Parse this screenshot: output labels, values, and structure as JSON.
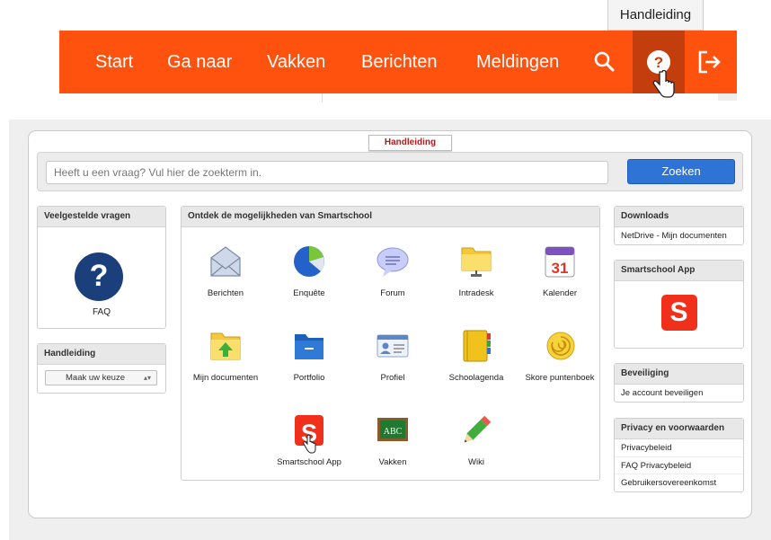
{
  "tooltip": "Handleiding",
  "nav": {
    "start": "Start",
    "ganaar": "Ga naar",
    "vakken": "Vakken",
    "berichten": "Berichten",
    "meldingen": "Meldingen"
  },
  "manual_tab": "Handleiding",
  "search": {
    "placeholder": "Heeft u een vraag? Vul hier de zoekterm in.",
    "button": "Zoeken"
  },
  "faq_panel": {
    "title": "Veelgestelde vragen",
    "label": "FAQ"
  },
  "manual_panel": {
    "title": "Handleiding",
    "select": "Maak uw keuze"
  },
  "discover": {
    "title": "Ontdek de mogelijkheden van Smartschool",
    "apps": [
      {
        "label": "Berichten",
        "icon": "envelope-icon"
      },
      {
        "label": "Enquête",
        "icon": "pie-chart-icon"
      },
      {
        "label": "Forum",
        "icon": "speech-bubble-icon"
      },
      {
        "label": "Intradesk",
        "icon": "network-folder-icon"
      },
      {
        "label": "Kalender",
        "icon": "calendar-icon",
        "day": "31"
      },
      {
        "label": "Mijn documenten",
        "icon": "upload-folder-icon"
      },
      {
        "label": "Portfolio",
        "icon": "blue-folder-icon"
      },
      {
        "label": "Profiel",
        "icon": "id-card-icon"
      },
      {
        "label": "Schoolagenda",
        "icon": "agenda-icon"
      },
      {
        "label": "Skore puntenboek",
        "icon": "snail-shell-icon"
      },
      {
        "label": "Smartschool App",
        "icon": "smartschool-s-icon",
        "letter": "S"
      },
      {
        "label": "Vakken",
        "icon": "chalkboard-icon",
        "board_text": "ABC"
      },
      {
        "label": "Wiki",
        "icon": "pencil-icon"
      }
    ]
  },
  "downloads": {
    "title": "Downloads",
    "links": [
      "NetDrive - Mijn documenten"
    ]
  },
  "app_panel": {
    "title": "Smartschool App",
    "letter": "S"
  },
  "security": {
    "title": "Beveiliging",
    "links": [
      "Je account beveiligen"
    ]
  },
  "privacy": {
    "title": "Privacy en voorwaarden",
    "links": [
      "Privacybeleid",
      "FAQ Privacybeleid",
      "Gebruikersovereenkomst"
    ]
  },
  "colors": {
    "nav": "#ff520e",
    "nav_active": "#c43e0d",
    "button": "#2e74d6",
    "faq": "#1a3f7b",
    "brand_red": "#f0301a"
  }
}
